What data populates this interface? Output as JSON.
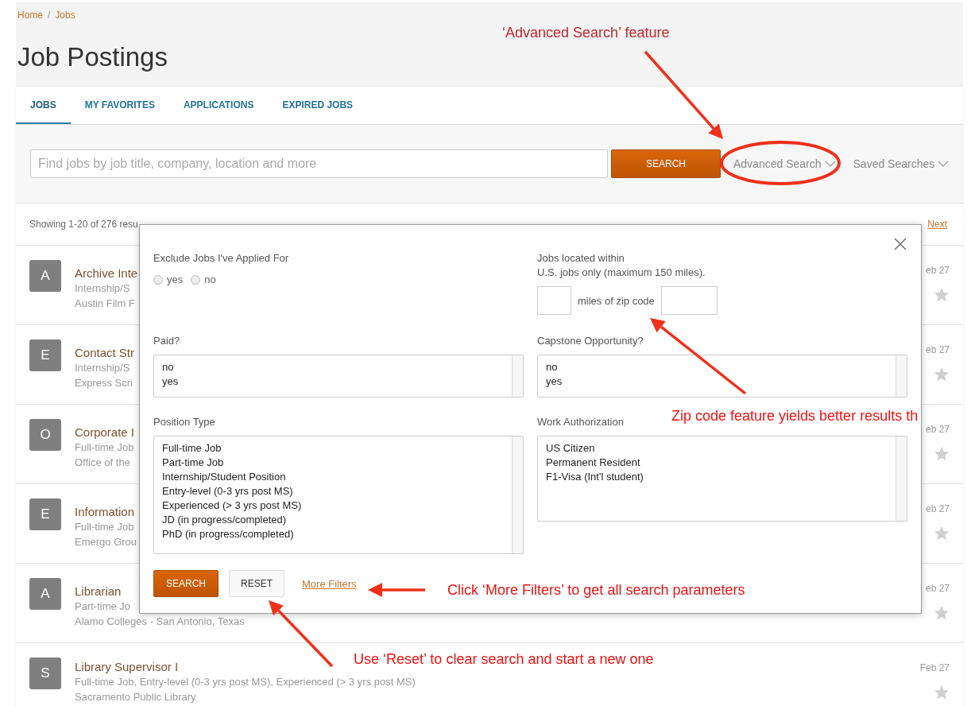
{
  "breadcrumb": {
    "items": [
      {
        "label": "Home"
      },
      {
        "label": "Jobs"
      }
    ],
    "separator": "/"
  },
  "title": "Job Postings",
  "tabs": [
    {
      "label": "JOBS",
      "selected": true
    },
    {
      "label": "MY FAVORITES",
      "selected": false
    },
    {
      "label": "APPLICATIONS",
      "selected": false
    },
    {
      "label": "EXPIRED JOBS",
      "selected": false
    }
  ],
  "search": {
    "placeholder": "Find jobs by job title, company, location and more",
    "button": "SEARCH",
    "advanced": "Advanced Search",
    "saved": "Saved Searches"
  },
  "results": {
    "summary": "Showing 1-20 of 276 resu",
    "next": "Next"
  },
  "jobs": [
    {
      "initial": "A",
      "title": "Archive Inte",
      "type": "Internship/S",
      "employer": "Austin Film F",
      "date": "eb 27",
      "favorite": false
    },
    {
      "initial": "E",
      "title": "Contact Str",
      "type": "Internship/S",
      "employer": "Express Scri",
      "date": "eb 27",
      "favorite": false
    },
    {
      "initial": "O",
      "title": "Corporate I",
      "type": "Full-time Job",
      "employer": "Office of the",
      "date": "eb 27",
      "favorite": false
    },
    {
      "initial": "E",
      "title": "Information",
      "type": "Full-time Job",
      "employer": "Emergo Grou",
      "date": "eb 27",
      "favorite": false
    },
    {
      "initial": "A",
      "title": "Librarian",
      "type": "Part-time Jo",
      "employer": "Alamo Colleges - San Antonio, Texas",
      "date": "eb 27",
      "favorite": false
    },
    {
      "initial": "S",
      "title": "Library Supervisor I",
      "type": "Full-time Job, Entry-level (0-3 yrs post MS), Experienced (> 3 yrs post MS)",
      "employer": "Sacramento Public Library",
      "date": "Feb 27",
      "favorite": false
    }
  ],
  "modal": {
    "exclude": {
      "label": "Exclude Jobs I've Applied For",
      "options": [
        {
          "label": "yes",
          "selected": false
        },
        {
          "label": "no",
          "selected": false
        }
      ]
    },
    "distance": {
      "label": "Jobs located within",
      "hint": "U.S. jobs only (maximum 150 miles).",
      "between": "miles of zip code"
    },
    "paid": {
      "label": "Paid?",
      "options": [
        "no",
        "yes"
      ]
    },
    "capstone": {
      "label": "Capstone Opportunity?",
      "options": [
        "no",
        "yes"
      ]
    },
    "position_type": {
      "label": "Position Type",
      "options": [
        "Full-time Job",
        "Part-time Job",
        "Internship/Student Position",
        "Entry-level (0-3 yrs post MS)",
        "Experienced (> 3 yrs post MS)",
        "JD (in progress/completed)",
        "PhD (in progress/completed)"
      ]
    },
    "work_authorization": {
      "label": "Work Authorization",
      "options": [
        "US Citizen",
        "Permanent Resident",
        "F1-Visa (Int'l student)"
      ]
    },
    "search_button": "SEARCH",
    "reset_button": "RESET",
    "more_filters": "More Filters"
  },
  "annotations": [
    {
      "text": "‘Advanced Search’ feature",
      "kind": "title"
    },
    {
      "text": "Zip code feature yields better results th",
      "kind": "note"
    },
    {
      "text": "Click ‘More Filters’ to get all search parameters",
      "kind": "note"
    },
    {
      "text": "Use ‘Reset’ to clear search and start a new one",
      "kind": "note"
    }
  ]
}
